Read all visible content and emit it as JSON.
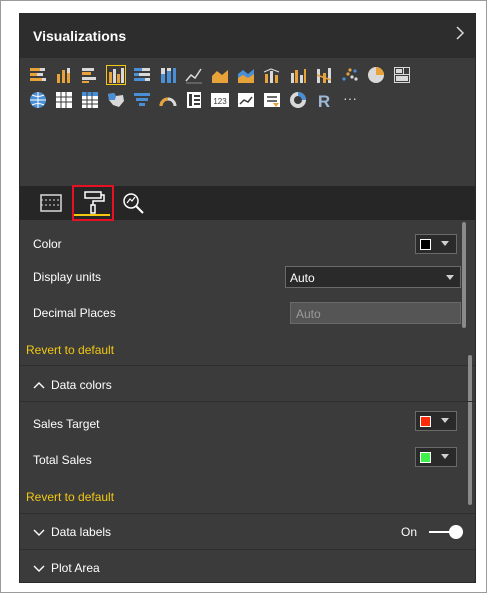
{
  "panel": {
    "title": "Visualizations",
    "expand_icon": "chevron-right-icon"
  },
  "viz_icons": {
    "row1": [
      "stacked-bar-icon",
      "stacked-column-icon",
      "clustered-bar-icon",
      "clustered-column-icon",
      "100-stacked-bar-icon",
      "100-stacked-column-icon",
      "line-chart-icon",
      "area-chart-icon",
      "stacked-area-icon",
      "line-column-icon",
      "line-clustered-column-icon",
      "ribbon-chart-icon",
      "scatter-chart-icon",
      "pie-chart-icon",
      "treemap-icon"
    ],
    "row2": [
      "map-icon",
      "table-icon",
      "matrix-icon",
      "filled-map-icon",
      "funnel-icon",
      "gauge-icon",
      "multi-row-card-icon",
      "card-icon",
      "kpi-icon",
      "slicer-icon",
      "donut-icon",
      "r-script-icon",
      "more-icon"
    ],
    "card_text": "123",
    "r_text": "R",
    "more_text": "···"
  },
  "tabs": {
    "fields": "fields-tab-icon",
    "format": "paint-roller-icon",
    "analytics": "analytics-magnifier-icon"
  },
  "format": {
    "color_label": "Color",
    "color_value": "#000000",
    "display_units_label": "Display units",
    "display_units_value": "Auto",
    "decimal_places_label": "Decimal Places",
    "decimal_places_placeholder": "Auto",
    "revert_1": "Revert to default",
    "data_colors_header": "Data colors",
    "sales_target_label": "Sales Target",
    "sales_target_color": "#ff2a0a",
    "total_sales_label": "Total Sales",
    "total_sales_color": "#3ef24a",
    "revert_2": "Revert to default",
    "data_labels_header": "Data labels",
    "data_labels_state": "On",
    "plot_area_header": "Plot Area"
  },
  "colors": {
    "accent_yellow": "#f2c811",
    "highlight_red": "#e81123"
  }
}
